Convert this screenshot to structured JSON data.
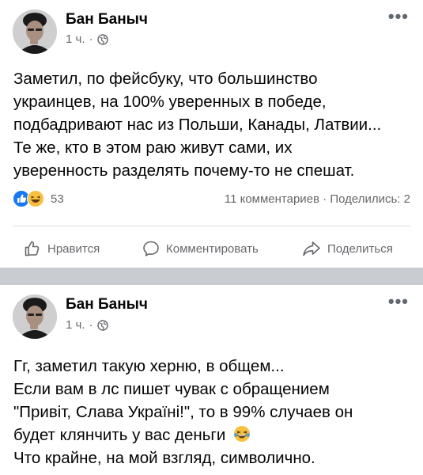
{
  "posts": [
    {
      "author": "Бан Баныч",
      "time": "1 ч.",
      "separator": "·",
      "privacy_icon": "globe-icon",
      "menu_icon": "more-dots-icon",
      "lines": [
        "Заметил, по фейсбуку, что большинство",
        "украинцев, на 100% уверенных в победе,",
        "подбадривают нас из Польши, Канады, Латвии...",
        "Те же, кто в этом раю живут сами, их",
        "уверенность разделять почему-то не спешат."
      ],
      "reaction_icons": [
        "like-reaction-icon",
        "laugh-reaction-icon"
      ],
      "reaction_count": "53",
      "comments": "11 комментариев",
      "stats_separator": "·",
      "shares": "Поделились: 2",
      "actions": {
        "like": "Нравится",
        "comment": "Комментировать",
        "share": "Поделиться"
      }
    },
    {
      "author": "Бан Баныч",
      "time": "1 ч.",
      "separator": "·",
      "privacy_icon": "globe-icon",
      "menu_icon": "more-dots-icon",
      "lines": [
        "Гг, заметил такую херню, в общем...",
        "Если вам в лс пишет чувак с обращением",
        "\"Привіт, Слава Україні!\", то в 99% случаев он",
        "будет клянчить у вас деньги",
        "Что крайне, на мой взгляд, символично."
      ],
      "inline_emoji": "laughing-tears-emoji-icon"
    }
  ],
  "colors": {
    "text": "#050505",
    "secondary": "#65676b",
    "divider": "#c9ccd1",
    "like_blue": "#1877f2",
    "emoji_yellow": "#f7c13f"
  }
}
